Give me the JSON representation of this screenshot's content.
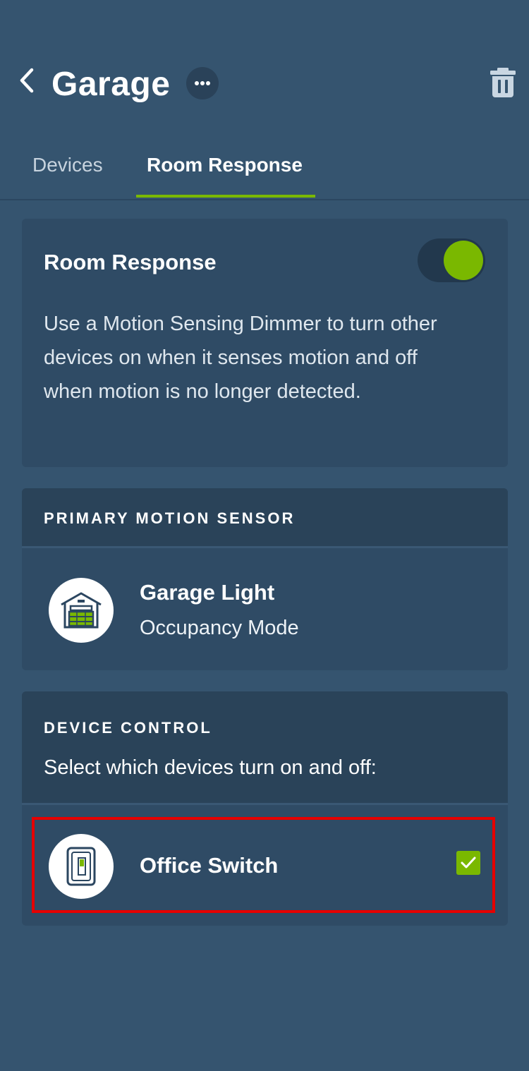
{
  "header": {
    "title": "Garage",
    "back_icon": "chevron-left-icon",
    "more_icon": "more-horizontal-icon",
    "delete_icon": "trash-icon"
  },
  "tabs": [
    {
      "label": "Devices",
      "active": false
    },
    {
      "label": "Room Response",
      "active": true
    }
  ],
  "room_response": {
    "title": "Room Response",
    "enabled": true,
    "description": "Use a Motion Sensing Dimmer to turn other devices on when it senses motion and off when motion is no longer detected."
  },
  "primary_motion_sensor": {
    "section_label": "PRIMARY MOTION SENSOR",
    "device": {
      "name": "Garage Light",
      "mode": "Occupancy Mode",
      "icon": "garage-icon"
    }
  },
  "device_control": {
    "section_label": "DEVICE CONTROL",
    "subtitle": "Select which devices turn on and off:",
    "devices": [
      {
        "name": "Office Switch",
        "icon": "light-switch-icon",
        "checked": true
      }
    ]
  },
  "colors": {
    "background": "#35546f",
    "card": "#2f4b65",
    "section_header": "#2a4359",
    "accent_green": "#7ab800",
    "highlight_red": "#e60000"
  }
}
